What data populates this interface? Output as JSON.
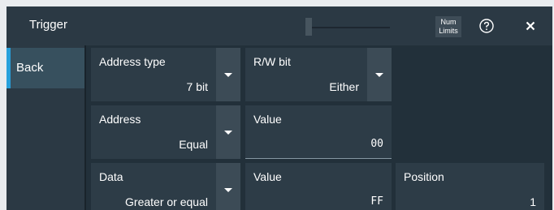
{
  "header": {
    "title": "Trigger",
    "num_limits_line1": "Num",
    "num_limits_line2": "Limits"
  },
  "sidebar": {
    "back_label": "Back"
  },
  "fields": {
    "address_type": {
      "label": "Address type",
      "value": "7 bit"
    },
    "rw_bit": {
      "label": "R/W bit",
      "value": "Either"
    },
    "address": {
      "label": "Address",
      "value": "Equal"
    },
    "address_value": {
      "label": "Value",
      "value": "00"
    },
    "data": {
      "label": "Data",
      "value": "Greater or equal"
    },
    "data_value": {
      "label": "Value",
      "value": "FF"
    },
    "position": {
      "label": "Position",
      "value": "1"
    }
  },
  "colors": {
    "accent": "#27a0db",
    "panel": "#22303a",
    "field": "#2d3c47"
  }
}
